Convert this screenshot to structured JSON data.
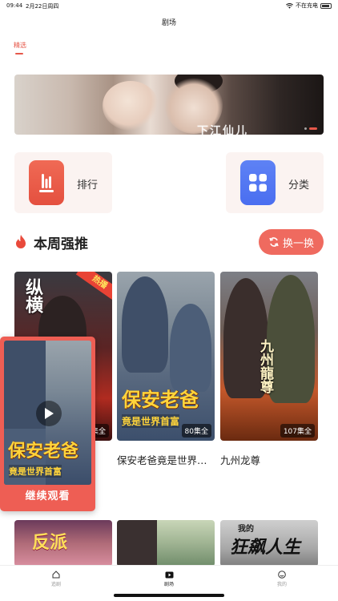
{
  "status_bar": {
    "time": "09:44",
    "date": "2月22日周四",
    "charging": "不在充电"
  },
  "nav": {
    "title": "剧场"
  },
  "tabs": {
    "featured": "精选"
  },
  "banner": {
    "text": "下江仙儿"
  },
  "categories": [
    {
      "label": "排行",
      "icon": "rank-chart-icon",
      "color": "#e4503f"
    },
    {
      "label": "分类",
      "icon": "grid-icon",
      "color": "#4a6ef0"
    }
  ],
  "section": {
    "title": "本周强推",
    "swap_label": "换一换"
  },
  "dramas": [
    {
      "title": "纵横",
      "poster_text": "纵横",
      "badge": "热播",
      "episodes": "集全"
    },
    {
      "title": "保安老爸竟是世界首富",
      "poster_text": "保安老爸",
      "poster_sub": "竟是世界首富",
      "episodes": "80集全"
    },
    {
      "title": "九州龙尊",
      "poster_text": "九州龍尊",
      "episodes": "107集全"
    }
  ],
  "more_dramas": [
    {
      "poster_text": "反派"
    },
    {
      "poster_text": ""
    },
    {
      "poster_text": "狂飙人生",
      "poster_tag": "我的"
    }
  ],
  "continue_watching": {
    "label": "继续观看",
    "poster_text": "保安老爸",
    "poster_sub": "竟是世界首富"
  },
  "tabbar": {
    "home": "追剧",
    "theater": "剧场",
    "mine": "我的"
  },
  "colors": {
    "accent": "#e6584a",
    "swap_button": "#ef6a5f",
    "classify_blue": "#4a6ef0"
  }
}
